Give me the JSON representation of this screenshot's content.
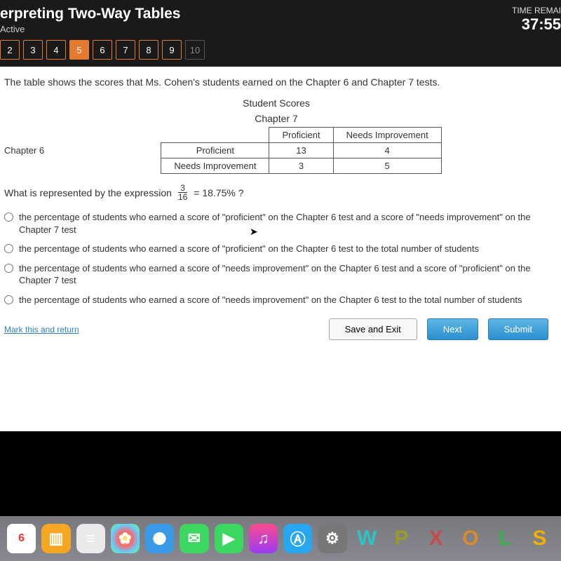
{
  "header": {
    "title": "erpreting Two-Way Tables",
    "status": "Active",
    "timer_label": "TIME REMAI",
    "timer_value": "37:55"
  },
  "nav": {
    "items": [
      "2",
      "3",
      "4",
      "5",
      "6",
      "7",
      "8",
      "9",
      "10"
    ],
    "active_index": 3,
    "disabled_index": 8
  },
  "content": {
    "prompt": "The table shows the scores that Ms. Cohen's students earned on the Chapter 6 and Chapter 7 tests.",
    "score_title": "Student Scores",
    "col_axis": "Chapter 7",
    "row_axis": "Chapter 6",
    "col_headers": [
      "Proficient",
      "Needs Improvement"
    ],
    "row_headers": [
      "Proficient",
      "Needs Improvement"
    ],
    "cells": [
      [
        "13",
        "4"
      ],
      [
        "3",
        "5"
      ]
    ],
    "question_pre": "What is represented by the expression",
    "frac_num": "3",
    "frac_den": "16",
    "eq_val": "= 18.75% ?",
    "options": [
      "the percentage of students who earned a score of \"proficient\" on the Chapter 6 test and a score of \"needs improvement\" on the Chapter 7 test",
      "the percentage of students who earned a score of \"proficient\" on the Chapter 6 test to the total number of students",
      "the percentage of students who earned a score of \"needs improvement\" on the Chapter 6 test and a score of \"proficient\" on the Chapter 7 test",
      "the percentage of students who earned a score of \"needs improvement\" on the Chapter 6 test to the total number of students"
    ],
    "mark_link": "Mark this and return",
    "save_label": "Save and Exit",
    "next_label": "Next",
    "submit_label": "Submit"
  },
  "dock": {
    "calendar_day": "6",
    "letters": [
      "W",
      "P",
      "X",
      "O",
      "L",
      "S"
    ]
  }
}
